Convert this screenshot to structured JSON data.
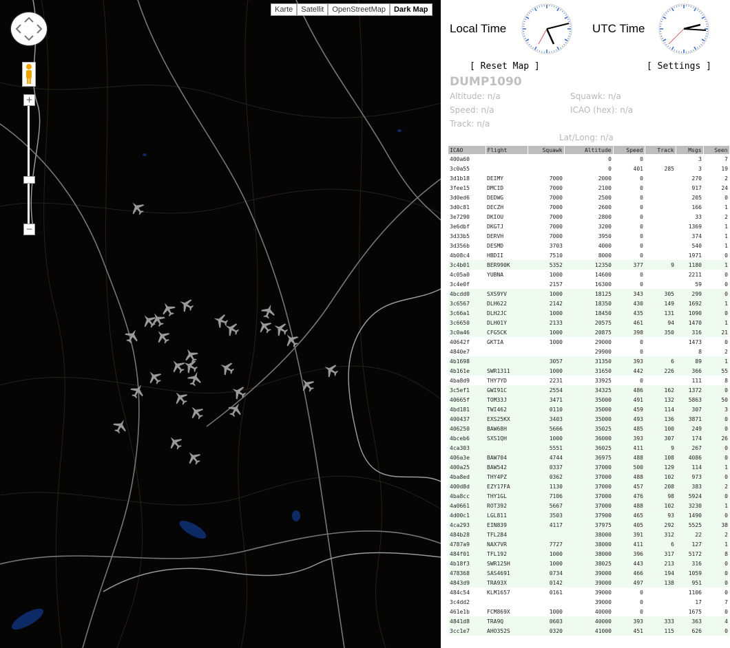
{
  "map": {
    "types": [
      "Karte",
      "Satellit",
      "OpenStreetMap",
      "Dark Map"
    ],
    "active_type": "Dark Map",
    "zoom_in": "+",
    "zoom_out": "−",
    "background": "#050505",
    "plane_color": "#9a9a9a",
    "icons": {
      "pan": "pan-control-icon",
      "pegman": "pegman-icon",
      "plane": "plane-icon"
    }
  },
  "clocks": {
    "local_label": "Local Time",
    "utc_label": "UTC Time"
  },
  "buttons": {
    "reset": "[ Reset Map ]",
    "settings": "[ Settings ]"
  },
  "selected": {
    "title": "DUMP1090",
    "altitude": "Altitude: n/a",
    "squawk": "Squawk: n/a",
    "speed": "Speed: n/a",
    "icao": "ICAO (hex): n/a",
    "track": "Track: n/a",
    "latlong": "Lat/Long: n/a"
  },
  "table": {
    "headers": [
      "ICAO",
      "Flight",
      "Squawk",
      "Altitude",
      "Speed",
      "Track",
      "Msgs",
      "Seen"
    ],
    "rows": [
      [
        "400a60",
        "",
        "",
        "0",
        "0",
        "",
        "3",
        "7",
        0
      ],
      [
        "3c0a55",
        "",
        "",
        "0",
        "401",
        "285",
        "3",
        "19",
        0
      ],
      [
        "3d1b18",
        "DEIMY",
        "7000",
        "2000",
        "0",
        "",
        "270",
        "2",
        0
      ],
      [
        "3fee15",
        "DMCID",
        "7000",
        "2100",
        "0",
        "",
        "917",
        "24",
        0
      ],
      [
        "3d0ed6",
        "DEDWG",
        "7000",
        "2500",
        "0",
        "",
        "205",
        "0",
        0
      ],
      [
        "3d0c81",
        "DECZH",
        "7000",
        "2600",
        "0",
        "",
        "166",
        "1",
        0
      ],
      [
        "3e7290",
        "DKIOU",
        "7000",
        "2800",
        "0",
        "",
        "33",
        "2",
        0
      ],
      [
        "3e6dbf",
        "DKGTJ",
        "7000",
        "3200",
        "0",
        "",
        "1369",
        "1",
        0
      ],
      [
        "3d33b5",
        "DERVH",
        "7000",
        "3950",
        "0",
        "",
        "374",
        "1",
        0
      ],
      [
        "3d356b",
        "DESMD",
        "3703",
        "4000",
        "0",
        "",
        "540",
        "1",
        0
      ],
      [
        "4b08c4",
        "HBDII",
        "7510",
        "8000",
        "0",
        "",
        "1971",
        "0",
        0
      ],
      [
        "3c4b01",
        "BER990K",
        "5352",
        "12350",
        "377",
        "9",
        "1180",
        "1",
        1
      ],
      [
        "4c05a0",
        "YUBNA",
        "1000",
        "14600",
        "0",
        "",
        "2211",
        "0",
        0
      ],
      [
        "3c4e0f",
        "",
        "2157",
        "16300",
        "0",
        "",
        "59",
        "0",
        0
      ],
      [
        "4bcdd0",
        "SXS9YV",
        "1000",
        "18125",
        "343",
        "305",
        "299",
        "0",
        1
      ],
      [
        "3c6567",
        "DLH622",
        "2142",
        "18350",
        "430",
        "149",
        "1692",
        "1",
        1
      ],
      [
        "3c66a1",
        "DLH2JC",
        "1000",
        "18450",
        "435",
        "131",
        "1090",
        "0",
        1
      ],
      [
        "3c6650",
        "DLH01Y",
        "2133",
        "20575",
        "461",
        "94",
        "1470",
        "1",
        1
      ],
      [
        "3c0a46",
        "CFG5CK",
        "1000",
        "20875",
        "398",
        "350",
        "316",
        "21",
        1
      ],
      [
        "40642f",
        "GKTIA",
        "1000",
        "29000",
        "0",
        "",
        "1473",
        "0",
        0
      ],
      [
        "4840e7",
        "",
        "",
        "29900",
        "0",
        "",
        "8",
        "2",
        0
      ],
      [
        "4b1698",
        "",
        "3057",
        "31350",
        "393",
        "6",
        "89",
        "1",
        1
      ],
      [
        "4b161e",
        "SWR1311",
        "1000",
        "31650",
        "442",
        "226",
        "366",
        "55",
        1
      ],
      [
        "4ba8d9",
        "THY7YD",
        "2231",
        "33925",
        "0",
        "",
        "111",
        "8",
        0
      ],
      [
        "3c5ef1",
        "GWI91C",
        "2554",
        "34325",
        "486",
        "162",
        "1372",
        "0",
        1
      ],
      [
        "40665f",
        "TOM33J",
        "3471",
        "35000",
        "491",
        "132",
        "5863",
        "50",
        1
      ],
      [
        "4bd181",
        "TWI462",
        "0110",
        "35000",
        "459",
        "114",
        "307",
        "3",
        1
      ],
      [
        "400437",
        "EXS25KX",
        "3403",
        "35000",
        "493",
        "136",
        "3871",
        "0",
        1
      ],
      [
        "406250",
        "BAW68H",
        "5666",
        "35025",
        "485",
        "100",
        "249",
        "0",
        1
      ],
      [
        "4bceb6",
        "SXS1QH",
        "1000",
        "36000",
        "393",
        "307",
        "174",
        "26",
        1
      ],
      [
        "4ca303",
        "",
        "5551",
        "36025",
        "411",
        "9",
        "267",
        "0",
        1
      ],
      [
        "406a3e",
        "BAW704",
        "4744",
        "36975",
        "488",
        "108",
        "4086",
        "0",
        1
      ],
      [
        "400a25",
        "BAW542",
        "0337",
        "37000",
        "500",
        "129",
        "114",
        "1",
        1
      ],
      [
        "4ba8ed",
        "THY4PZ",
        "0362",
        "37000",
        "488",
        "102",
        "973",
        "0",
        1
      ],
      [
        "400d8d",
        "EZY17FA",
        "1130",
        "37000",
        "457",
        "208",
        "383",
        "2",
        1
      ],
      [
        "4ba8cc",
        "THY1GL",
        "7106",
        "37000",
        "476",
        "98",
        "5924",
        "0",
        1
      ],
      [
        "4a0661",
        "ROT392",
        "5667",
        "37000",
        "488",
        "102",
        "3230",
        "1",
        1
      ],
      [
        "4d00c1",
        "LGL811",
        "3503",
        "37900",
        "465",
        "93",
        "1490",
        "0",
        1
      ],
      [
        "4ca293",
        "EIN839",
        "4117",
        "37975",
        "405",
        "292",
        "5525",
        "38",
        1
      ],
      [
        "484b28",
        "TFL284",
        "",
        "38000",
        "391",
        "312",
        "22",
        "2",
        1
      ],
      [
        "4787a9",
        "NAX7VR",
        "7727",
        "38000",
        "411",
        "6",
        "127",
        "1",
        1
      ],
      [
        "484f01",
        "TFL192",
        "1000",
        "38000",
        "396",
        "317",
        "5172",
        "8",
        1
      ],
      [
        "4b18f3",
        "SWR125H",
        "1000",
        "38025",
        "443",
        "213",
        "316",
        "0",
        1
      ],
      [
        "478368",
        "SAS4691",
        "0734",
        "39000",
        "466",
        "194",
        "1059",
        "0",
        1
      ],
      [
        "4843d9",
        "TRA93X",
        "0142",
        "39000",
        "497",
        "138",
        "951",
        "0",
        1
      ],
      [
        "484c54",
        "KLM1657",
        "0161",
        "39000",
        "0",
        "",
        "1106",
        "0",
        0
      ],
      [
        "3c4dd2",
        "",
        "",
        "39000",
        "0",
        "",
        "17",
        "7",
        0
      ],
      [
        "461e1b",
        "FCM869X",
        "1000",
        "40000",
        "0",
        "",
        "1675",
        "0",
        0
      ],
      [
        "4841d8",
        "TRA9Q",
        "0603",
        "40000",
        "393",
        "333",
        "363",
        "4",
        1
      ],
      [
        "3cc1e7",
        "AHO352S",
        "0320",
        "41000",
        "451",
        "115",
        "626",
        "0",
        1
      ]
    ]
  }
}
